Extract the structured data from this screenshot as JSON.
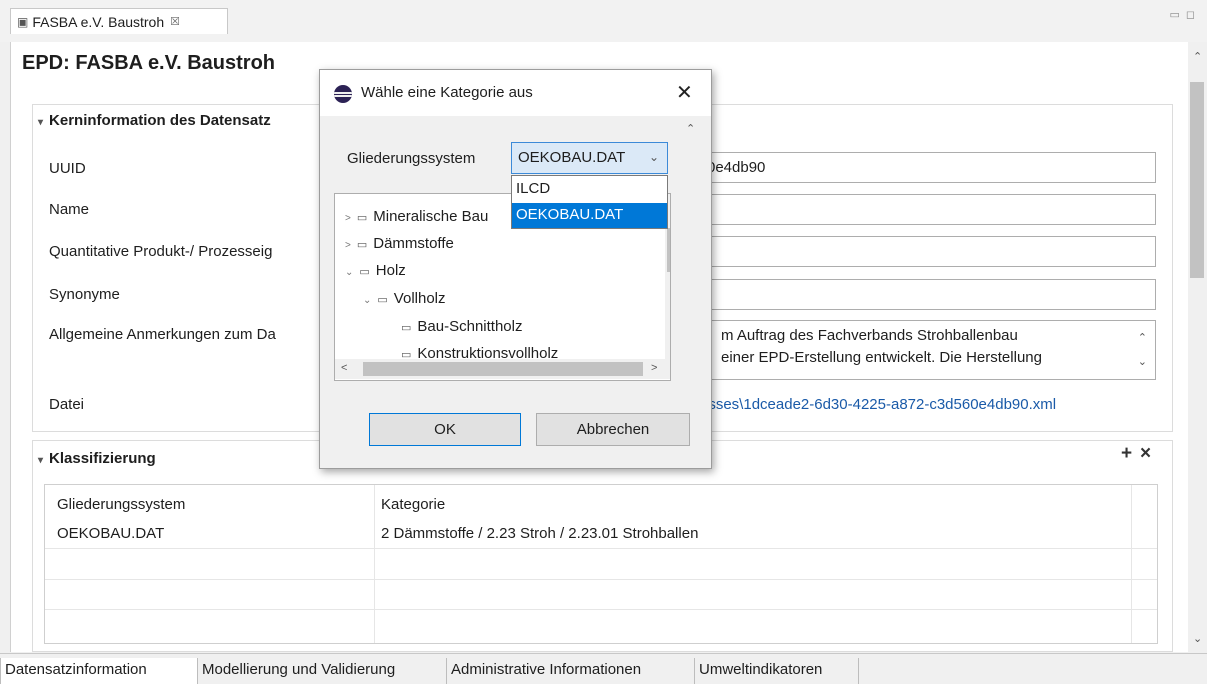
{
  "editor": {
    "tab_title": "FASBA e.V. Baustroh",
    "tab_close": "☒",
    "page_title": "EPD: FASBA e.V. Baustroh"
  },
  "kern": {
    "header": "Kerninformation des Datensatz",
    "labels": {
      "uuid": "UUID",
      "name": "Name",
      "quant": "Quantitative Produkt-/ Prozesseig",
      "synonyme": "Synonyme",
      "anmerkungen": "Allgemeine Anmerkungen zum Da",
      "datei": "Datei"
    },
    "values": {
      "uuid": "0e4db90",
      "anmerkungen_line1": "m Auftrag des Fachverbands Strohballenbau",
      "anmerkungen_line2": "einer EPD-Erstellung entwickelt. Die Herstellung",
      "datei": "esses\\1dceade2-6d30-4225-a872-c3d560e4db90.xml"
    }
  },
  "klassifizierung": {
    "header": "Klassifizierung",
    "add": "+",
    "remove": "×",
    "columns": [
      "Gliederungssystem",
      "Kategorie"
    ],
    "rows": [
      [
        "OEKOBAU.DAT",
        "2 Dämmstoffe / 2.23 Stroh / 2.23.01 Strohballen"
      ]
    ]
  },
  "bottom_tabs": [
    "Datensatzinformation",
    "Modellierung und Validierung",
    "Administrative Informationen",
    "Umweltindikatoren"
  ],
  "dialog": {
    "title": "Wähle eine Kategorie aus",
    "close": "✕",
    "label": "Gliederungssystem",
    "selected": "OEKOBAU.DAT",
    "options": [
      "ILCD",
      "OEKOBAU.DAT"
    ],
    "tree": [
      {
        "label": "Mineralische Bau",
        "expanded": false
      },
      {
        "label": "Dämmstoffe",
        "expanded": false
      },
      {
        "label": "Holz",
        "expanded": true
      },
      {
        "label": "Vollholz",
        "expanded": true
      },
      {
        "label": "Bau-Schnittholz",
        "expanded": null
      },
      {
        "label": "Konstruktionsvollholz",
        "expanded": null
      }
    ],
    "ok": "OK",
    "cancel": "Abbrechen"
  }
}
